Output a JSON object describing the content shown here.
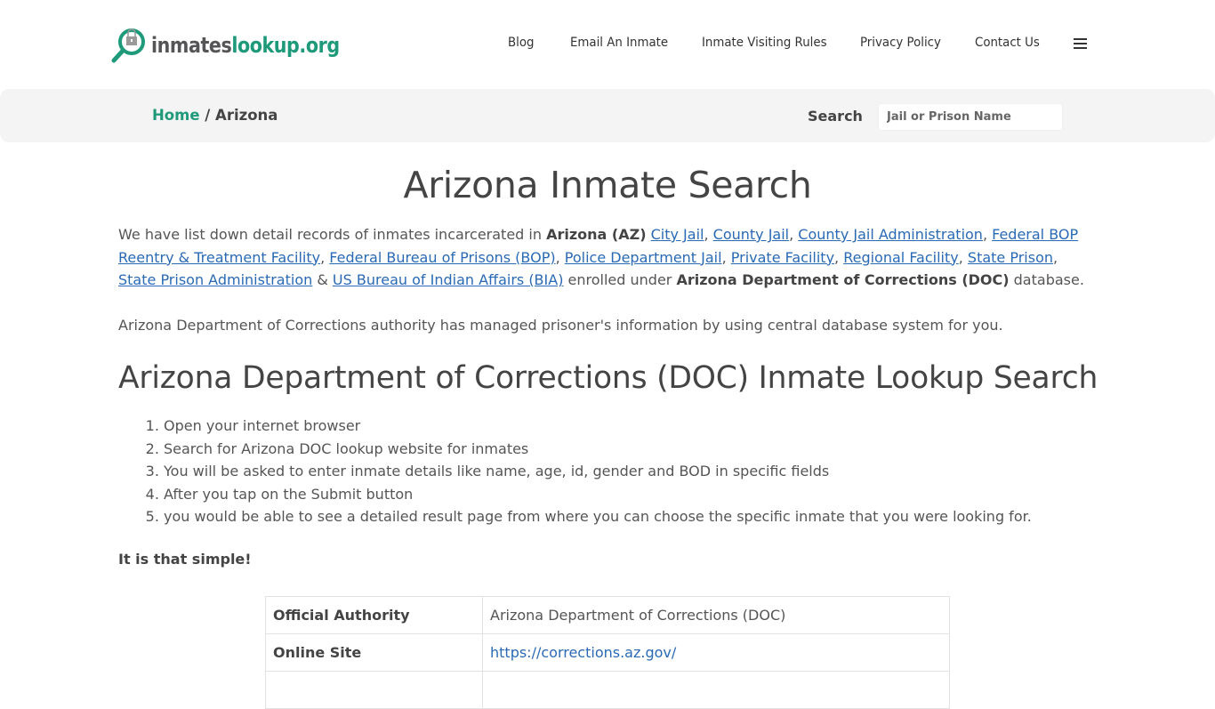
{
  "header": {
    "logo": {
      "text_dark": "inmates",
      "text_green": "lookup.org",
      "icon": "magnifier-lock-icon"
    },
    "nav": [
      {
        "label": "Blog"
      },
      {
        "label": "Email An Inmate"
      },
      {
        "label": "Inmate Visiting Rules"
      },
      {
        "label": "Privacy Policy"
      },
      {
        "label": "Contact Us"
      }
    ],
    "menu_icon": "hamburger-menu-icon"
  },
  "breadcrumb": {
    "home": "Home",
    "separator": " / ",
    "current": "Arizona"
  },
  "search": {
    "label": "Search",
    "placeholder": "Jail or Prison Name",
    "value": ""
  },
  "main": {
    "title": "Arizona Inmate Search",
    "intro": {
      "prefix": "We have list down detail records of inmates incarcerated in ",
      "state_bold": "Arizona (AZ)",
      "links": [
        "City Jail",
        "County Jail",
        "County Jail Administration",
        "Federal BOP Reentry & Treatment Facility",
        "Federal Bureau of Prisons (BOP)",
        "Police Department Jail",
        "Private Facility",
        "Regional Facility",
        "State Prison",
        "State Prison Administration",
        "US Bureau of Indian Affairs (BIA)"
      ],
      "amp": " & ",
      "middle": " enrolled under ",
      "dept_bold": "Arizona Department of Corrections (DOC)",
      "suffix": " database."
    },
    "paragraph2": "Arizona Department of Corrections authority has managed prisoner's information by using central database system for you.",
    "section_title": "Arizona Department of Corrections (DOC) Inmate Lookup Search",
    "steps": [
      "Open your internet browser",
      "Search for Arizona DOC lookup website for inmates",
      "You will be asked to enter inmate details like name, age, id, gender and BOD in specific fields",
      "After you tap on the Submit button",
      "you would be able to see a detailed result page from where you can choose the specific inmate that you were looking for."
    ],
    "simple": "It is that simple!",
    "table": [
      {
        "key": "Official Authority",
        "value": "Arizona Department of Corrections (DOC)",
        "is_link": false
      },
      {
        "key": "Online Site",
        "value": "https://corrections.az.gov/",
        "is_link": true
      },
      {
        "key": "",
        "value": "",
        "is_link": false
      }
    ]
  },
  "colors": {
    "brand_green": "#1e9a7a",
    "link_blue": "#2a6ab5",
    "text": "#555555",
    "crumb_bg": "#f4f4f4"
  }
}
